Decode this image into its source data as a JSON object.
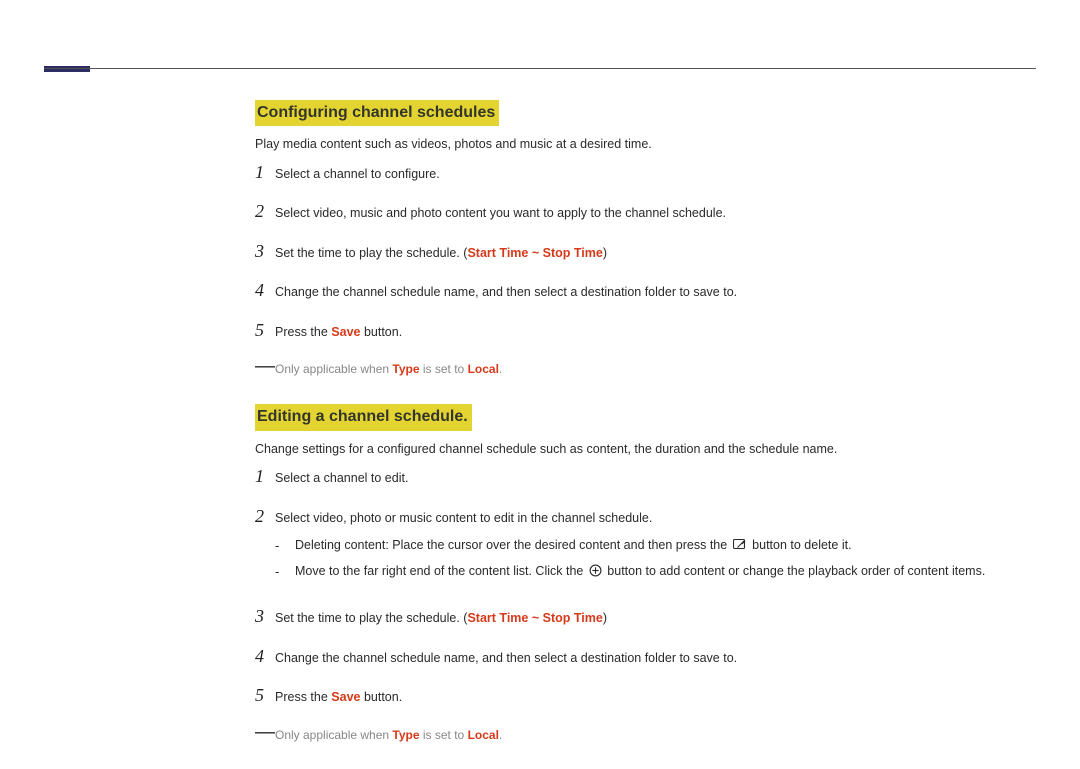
{
  "section1": {
    "heading": "Configuring channel schedules",
    "intro": "Play media content such as videos, photos and music at a desired time.",
    "steps": {
      "s1": "Select a channel to configure.",
      "s2": "Select video, music and photo content you want to apply to the channel schedule.",
      "s3_prefix": "Set the time to play the schedule. (",
      "s3_range": "Start Time ~ Stop Time",
      "s3_suffix": ")",
      "s4": "Change the channel schedule name, and then select a destination folder to save to.",
      "s5_prefix": "Press the ",
      "s5_save": "Save",
      "s5_suffix": " button."
    },
    "note": {
      "prefix": "Only applicable when ",
      "type": "Type",
      "middle": " is set to ",
      "local": "Local",
      "suffix": "."
    }
  },
  "section2": {
    "heading": "Editing a channel schedule.",
    "intro": "Change settings for a configured channel schedule such as content, the duration and the schedule name.",
    "steps": {
      "s1": "Select a channel to edit.",
      "s2": "Select video, photo or music content to edit in the channel schedule.",
      "s2_sub1_prefix": "Deleting content: Place the cursor over the desired content and then press the ",
      "s2_sub1_suffix": " button to delete it.",
      "s2_sub2_prefix": "Move to the far right end of the content list. Click the ",
      "s2_sub2_suffix": " button to add content or change the playback order of content items.",
      "s3_prefix": "Set the time to play the schedule. (",
      "s3_range": "Start Time ~ Stop Time",
      "s3_suffix": ")",
      "s4": "Change the channel schedule name, and then select a destination folder to save to.",
      "s5_prefix": "Press the ",
      "s5_save": "Save",
      "s5_suffix": " button."
    },
    "note": {
      "prefix": "Only applicable when ",
      "type": "Type",
      "middle": " is set to ",
      "local": "Local",
      "suffix": "."
    }
  },
  "numbers": {
    "n1": "1",
    "n2": "2",
    "n3": "3",
    "n4": "4",
    "n5": "5"
  },
  "dashes": {
    "bullet": "-",
    "note": "―"
  }
}
